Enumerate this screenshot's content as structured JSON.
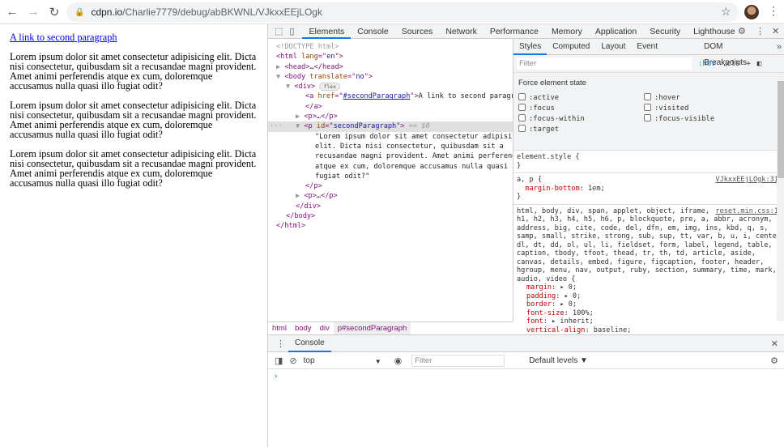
{
  "browser": {
    "url_host": "cdpn.io",
    "url_path": "/Charlie7779/debug/abBKWNL/VJkxxEEjLOgk"
  },
  "page": {
    "link": "A link to second paragraph",
    "paragraphs": [
      "Lorem ipsum dolor sit amet consectetur adipisicing elit. Dicta nisi consectetur, quibusdam sit a recusandae magni provident. Amet animi perferendis atque ex cum, doloremque accusamus nulla quasi illo fugiat odit?",
      "Lorem ipsum dolor sit amet consectetur adipisicing elit. Dicta nisi consectetur, quibusdam sit a recusandae magni provident. Amet animi perferendis atque ex cum, doloremque accusamus nulla quasi illo fugiat odit?",
      "Lorem ipsum dolor sit amet consectetur adipisicing elit. Dicta nisi consectetur, quibusdam sit a recusandae magni provident. Amet animi perferendis atque ex cum, doloremque accusamus nulla quasi illo fugiat odit?"
    ]
  },
  "devtools": {
    "tabs": [
      "Elements",
      "Console",
      "Sources",
      "Network",
      "Performance",
      "Memory",
      "Application",
      "Security",
      "Lighthouse"
    ],
    "dom_lines": [
      {
        "i": 0,
        "p": [
          [
            "cm",
            "<!DOCTYPE html>"
          ]
        ]
      },
      {
        "i": 0,
        "p": [
          [
            "tag",
            "<html "
          ],
          [
            "attr",
            "lang"
          ],
          [
            "tag",
            "=\""
          ],
          [
            "val",
            "en"
          ],
          [
            "tag",
            "\">"
          ]
        ]
      },
      {
        "i": 0,
        "p": [
          [
            "cm",
            "▶ "
          ],
          [
            "tag",
            "<head>"
          ],
          [
            "txt",
            "…"
          ],
          [
            "tag",
            "</head>"
          ]
        ]
      },
      {
        "i": 0,
        "p": [
          [
            "cm",
            "▼ "
          ],
          [
            "tag",
            "<body "
          ],
          [
            "attr",
            "translate"
          ],
          [
            "tag",
            "=\""
          ],
          [
            "val",
            "no"
          ],
          [
            "tag",
            "\">"
          ]
        ]
      },
      {
        "i": 1,
        "p": [
          [
            "cm",
            "▼ "
          ],
          [
            "tag",
            "<div>"
          ],
          [
            "txt",
            " "
          ],
          [
            "badge",
            "flex"
          ]
        ]
      },
      {
        "i": 3,
        "p": [
          [
            "tag",
            "<a "
          ],
          [
            "attr",
            "href"
          ],
          [
            "tag",
            "=\""
          ],
          [
            "lnk",
            "#secondParagraph"
          ],
          [
            "tag",
            "\">"
          ],
          [
            "txt",
            "A link to second paragraph"
          ]
        ]
      },
      {
        "i": 3,
        "p": [
          [
            "tag",
            "</a>"
          ]
        ]
      },
      {
        "i": 2,
        "p": [
          [
            "cm",
            "▶ "
          ],
          [
            "tag",
            "<p>"
          ],
          [
            "txt",
            "…"
          ],
          [
            "tag",
            "</p>"
          ]
        ]
      },
      {
        "i": 2,
        "sel": true,
        "p": [
          [
            "cm",
            "▼ "
          ],
          [
            "tag",
            "<p "
          ],
          [
            "attr",
            "id"
          ],
          [
            "tag",
            "=\""
          ],
          [
            "val",
            "secondParagraph"
          ],
          [
            "tag",
            "\">"
          ],
          [
            "dim",
            " == $0"
          ]
        ]
      },
      {
        "i": 4,
        "p": [
          [
            "txt",
            "\"Lorem ipsum dolor sit amet consectetur adipisicing"
          ]
        ]
      },
      {
        "i": 4,
        "p": [
          [
            "txt",
            "elit. Dicta nisi consectetur, quibusdam sit a"
          ]
        ]
      },
      {
        "i": 4,
        "p": [
          [
            "txt",
            "recusandae magni provident. Amet animi perferendis"
          ]
        ]
      },
      {
        "i": 4,
        "p": [
          [
            "txt",
            "atque ex cum, doloremque accusamus nulla quasi illo"
          ]
        ]
      },
      {
        "i": 4,
        "p": [
          [
            "txt",
            "fugiat odit?\""
          ]
        ]
      },
      {
        "i": 3,
        "p": [
          [
            "tag",
            "</p>"
          ]
        ]
      },
      {
        "i": 2,
        "p": [
          [
            "cm",
            "▶ "
          ],
          [
            "tag",
            "<p>"
          ],
          [
            "txt",
            "…"
          ],
          [
            "tag",
            "</p>"
          ]
        ]
      },
      {
        "i": 2,
        "p": [
          [
            "tag",
            "</div>"
          ]
        ]
      },
      {
        "i": 1,
        "p": [
          [
            "tag",
            "</body>"
          ]
        ]
      },
      {
        "i": 0,
        "p": [
          [
            "tag",
            "</html>"
          ]
        ]
      }
    ],
    "styles_tabs": [
      "Styles",
      "Computed",
      "Layout",
      "Event Listeners",
      "DOM Breakpoints"
    ],
    "filter_placeholder": "Filter",
    "hov": ":hov",
    "cls": ".cls",
    "force_title": "Force element state",
    "states": [
      ":active",
      ":hover",
      ":focus",
      ":visited",
      ":focus-within",
      ":focus-visible",
      ":target"
    ],
    "element_style": "element.style {\n}",
    "rule1": {
      "text": "a, p {\n  ",
      "prop": "margin-bottom",
      "val": ": 1em;\n}",
      "src": "VJkxxEEjLOgk:31"
    },
    "rule2": {
      "selector": "html, body, div, span, applet, object, iframe,\nh1, h2, h3, h4, h5, h6, p, blockquote, pre, a, abbr, acronym,\naddress, big, cite, code, del, dfn, em, img, ins, kbd, q, s,\nsamp, small, strike, strong, sub, sup, tt, var, b, u, i, center,\ndl, dt, dd, ol, ul, li, fieldset, form, label, legend, table,\ncaption, tbody, tfoot, thead, tr, th, td, article, aside,\ncanvas, details, embed, figure, figcaption, footer, header,\nhgroup, menu, nav, output, ruby, section, summary, time, mark,\naudio, video {",
      "src": "reset.min.css:1",
      "props": [
        [
          "margin",
          ": ▸ 0;"
        ],
        [
          "padding",
          ": ▸ 0;"
        ],
        [
          "border",
          ": ▸ 0;"
        ],
        [
          "font-size",
          ": 100%;"
        ],
        [
          "font",
          ": ▸ inherit;"
        ],
        [
          "vertical-align",
          ": baseline;"
        ]
      ]
    },
    "breadcrumbs": [
      "html",
      "body",
      "div",
      "p#secondParagraph"
    ],
    "drawer_tab": "Console",
    "context": "top",
    "console_filter": "Filter",
    "levels": "Default levels ▼",
    "prompt": "›"
  }
}
